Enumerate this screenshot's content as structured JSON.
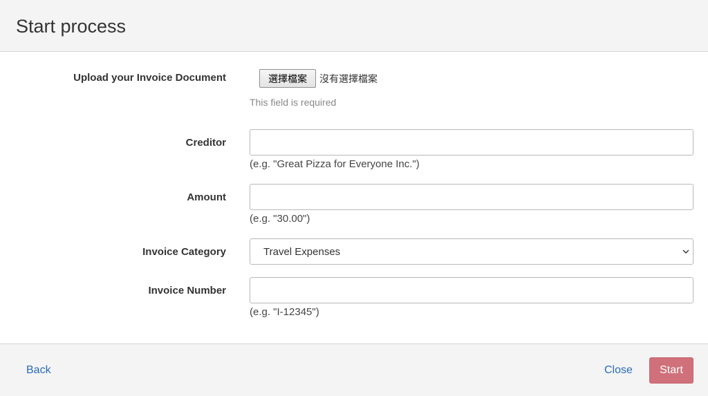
{
  "header": {
    "title": "Start process"
  },
  "form": {
    "upload": {
      "label": "Upload your Invoice Document",
      "button_label": "選擇檔案",
      "status": "沒有選擇檔案",
      "error": "This field is required"
    },
    "creditor": {
      "label": "Creditor",
      "value": "",
      "help": "(e.g. \"Great Pizza for Everyone Inc.\")"
    },
    "amount": {
      "label": "Amount",
      "value": "",
      "help": "(e.g. \"30.00\")"
    },
    "category": {
      "label": "Invoice Category",
      "selected": "Travel Expenses"
    },
    "invoice_number": {
      "label": "Invoice Number",
      "value": "",
      "help": "(e.g. \"I-12345\")"
    }
  },
  "footer": {
    "back_label": "Back",
    "close_label": "Close",
    "start_label": "Start"
  },
  "colors": {
    "link": "#2a6bb8",
    "start_button": "#d0707a",
    "header_bg": "#f4f4f4"
  },
  "icons": {
    "select_chevron": "chevron-down-icon"
  }
}
